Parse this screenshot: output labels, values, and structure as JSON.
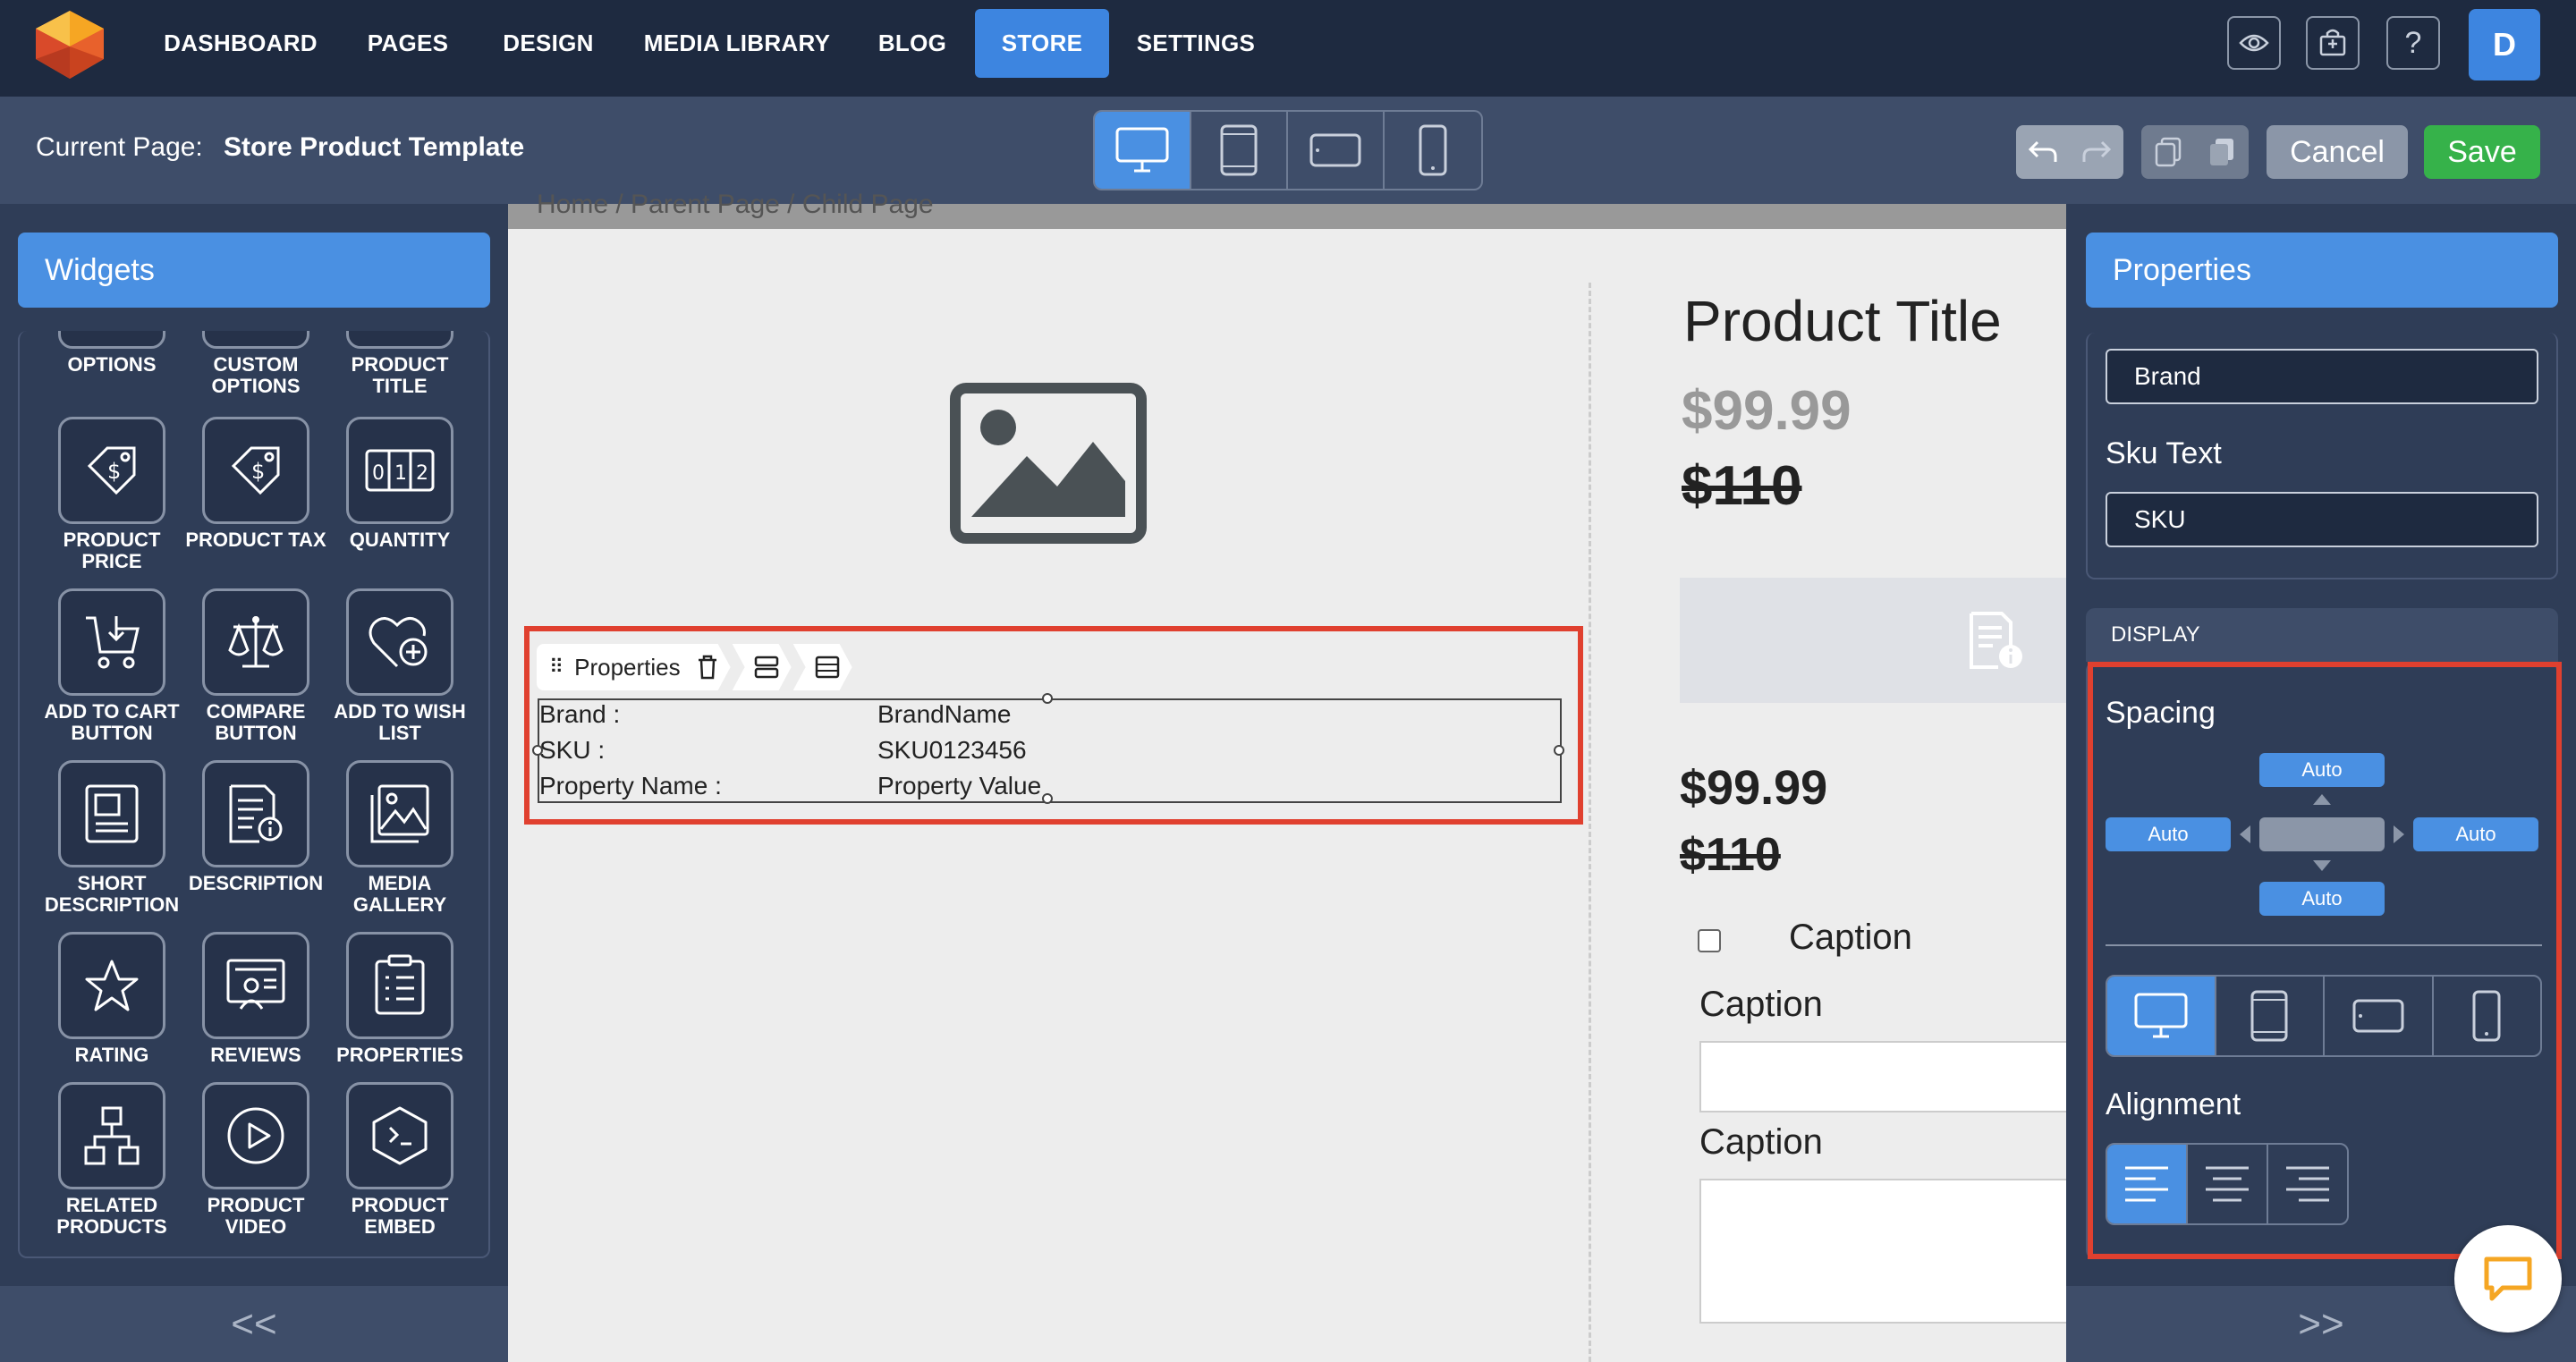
{
  "nav": {
    "items": [
      {
        "label": "DASHBOARD"
      },
      {
        "label": "PAGES"
      },
      {
        "label": "DESIGN"
      },
      {
        "label": "MEDIA LIBRARY"
      },
      {
        "label": "BLOG"
      },
      {
        "label": "STORE",
        "active": true
      },
      {
        "label": "SETTINGS"
      }
    ],
    "avatar": "D"
  },
  "subbar": {
    "current_page_label": "Current Page:",
    "current_page_value": "Store Product Template",
    "cancel_label": "Cancel",
    "save_label": "Save"
  },
  "widgets": {
    "header": "Widgets",
    "items": [
      {
        "label": "OPTIONS",
        "icon": "options-icon"
      },
      {
        "label": "CUSTOM OPTIONS",
        "icon": "custom-options-icon"
      },
      {
        "label": "PRODUCT TITLE",
        "icon": "product-title-icon"
      },
      {
        "label": "PRODUCT PRICE",
        "icon": "price-tag-icon"
      },
      {
        "label": "PRODUCT TAX",
        "icon": "tax-tag-icon"
      },
      {
        "label": "QUANTITY",
        "icon": "quantity-icon"
      },
      {
        "label": "ADD TO CART BUTTON",
        "icon": "cart-icon"
      },
      {
        "label": "COMPARE BUTTON",
        "icon": "scale-icon"
      },
      {
        "label": "ADD TO WISH LIST",
        "icon": "heart-plus-icon"
      },
      {
        "label": "SHORT DESCRIPTION",
        "icon": "short-description-icon"
      },
      {
        "label": "DESCRIPTION",
        "icon": "description-icon"
      },
      {
        "label": "MEDIA GALLERY",
        "icon": "gallery-icon"
      },
      {
        "label": "RATING",
        "icon": "star-icon"
      },
      {
        "label": "REVIEWS",
        "icon": "reviews-icon"
      },
      {
        "label": "PROPERTIES",
        "icon": "properties-icon"
      },
      {
        "label": "RELATED PRODUCTS",
        "icon": "related-icon"
      },
      {
        "label": "PRODUCT VIDEO",
        "icon": "play-icon"
      },
      {
        "label": "PRODUCT EMBED",
        "icon": "embed-icon"
      }
    ],
    "collapse": "<<"
  },
  "canvas": {
    "breadcrumb": "Home  /  Parent Page  /  Child Page",
    "toolbar_label": "Properties",
    "properties": [
      {
        "name": "Brand :",
        "value": "BrandName"
      },
      {
        "name": "SKU :",
        "value": "SKU0123456"
      },
      {
        "name": "Property Name :",
        "value": "Property Value"
      }
    ],
    "product_title": "Product Title",
    "price": "$99.99",
    "old_price": "$110",
    "price2": "$99.99",
    "old_price2": "$110",
    "caption_checkbox": "Caption",
    "caption_input": "Caption",
    "caption_textarea": "Caption"
  },
  "properties_panel": {
    "header": "Properties",
    "brand_value": "Brand",
    "sku_text_label": "Sku Text",
    "sku_value": "SKU",
    "display_header": "DISPLAY",
    "spacing_label": "Spacing",
    "spacing": {
      "top": "Auto",
      "left": "Auto",
      "right": "Auto",
      "bottom": "Auto"
    },
    "alignment_label": "Alignment",
    "collapse": ">>"
  },
  "colors": {
    "accent": "#4a90e2",
    "nav_bg": "#1e2a40",
    "panel_bg": "#2f3d57",
    "save": "#36b24a",
    "highlight": "#e0402f"
  }
}
